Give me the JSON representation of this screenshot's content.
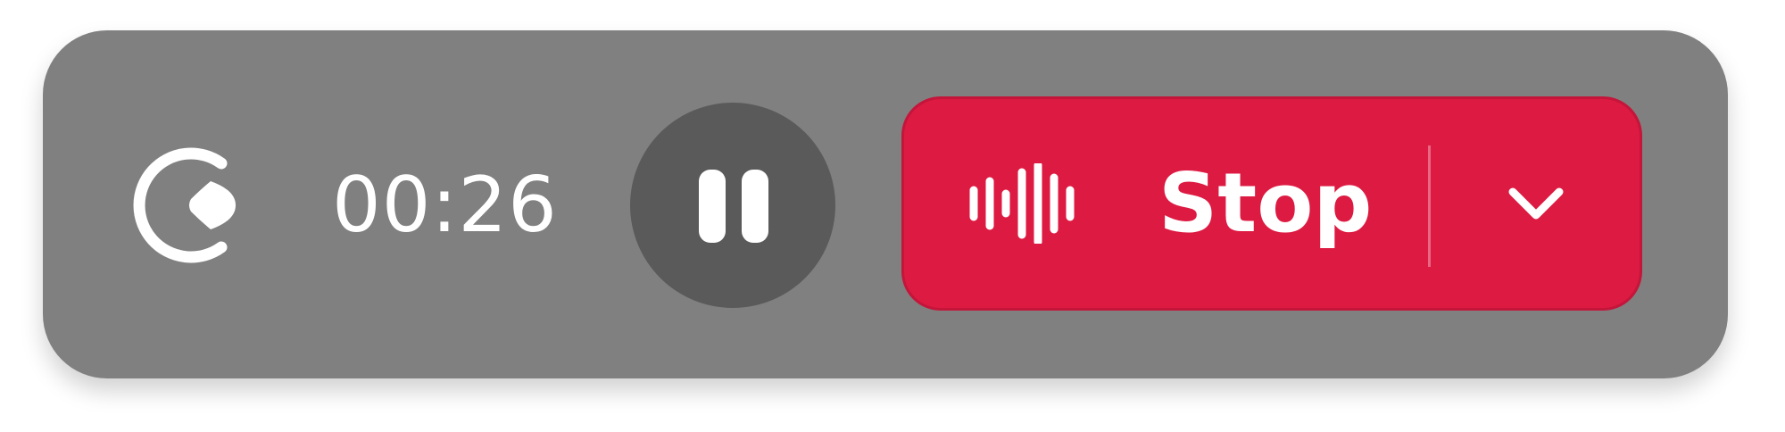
{
  "recorder": {
    "timer": "00:26",
    "stop_label": "Stop",
    "icons": {
      "logo": "loom-style-logo-icon",
      "pause": "pause-icon",
      "waveform": "audio-waveform-icon",
      "dropdown": "chevron-down-icon"
    },
    "colors": {
      "bar": "#808080",
      "pause_button": "#5a5a5a",
      "stop_button": "#dd1a42"
    }
  }
}
